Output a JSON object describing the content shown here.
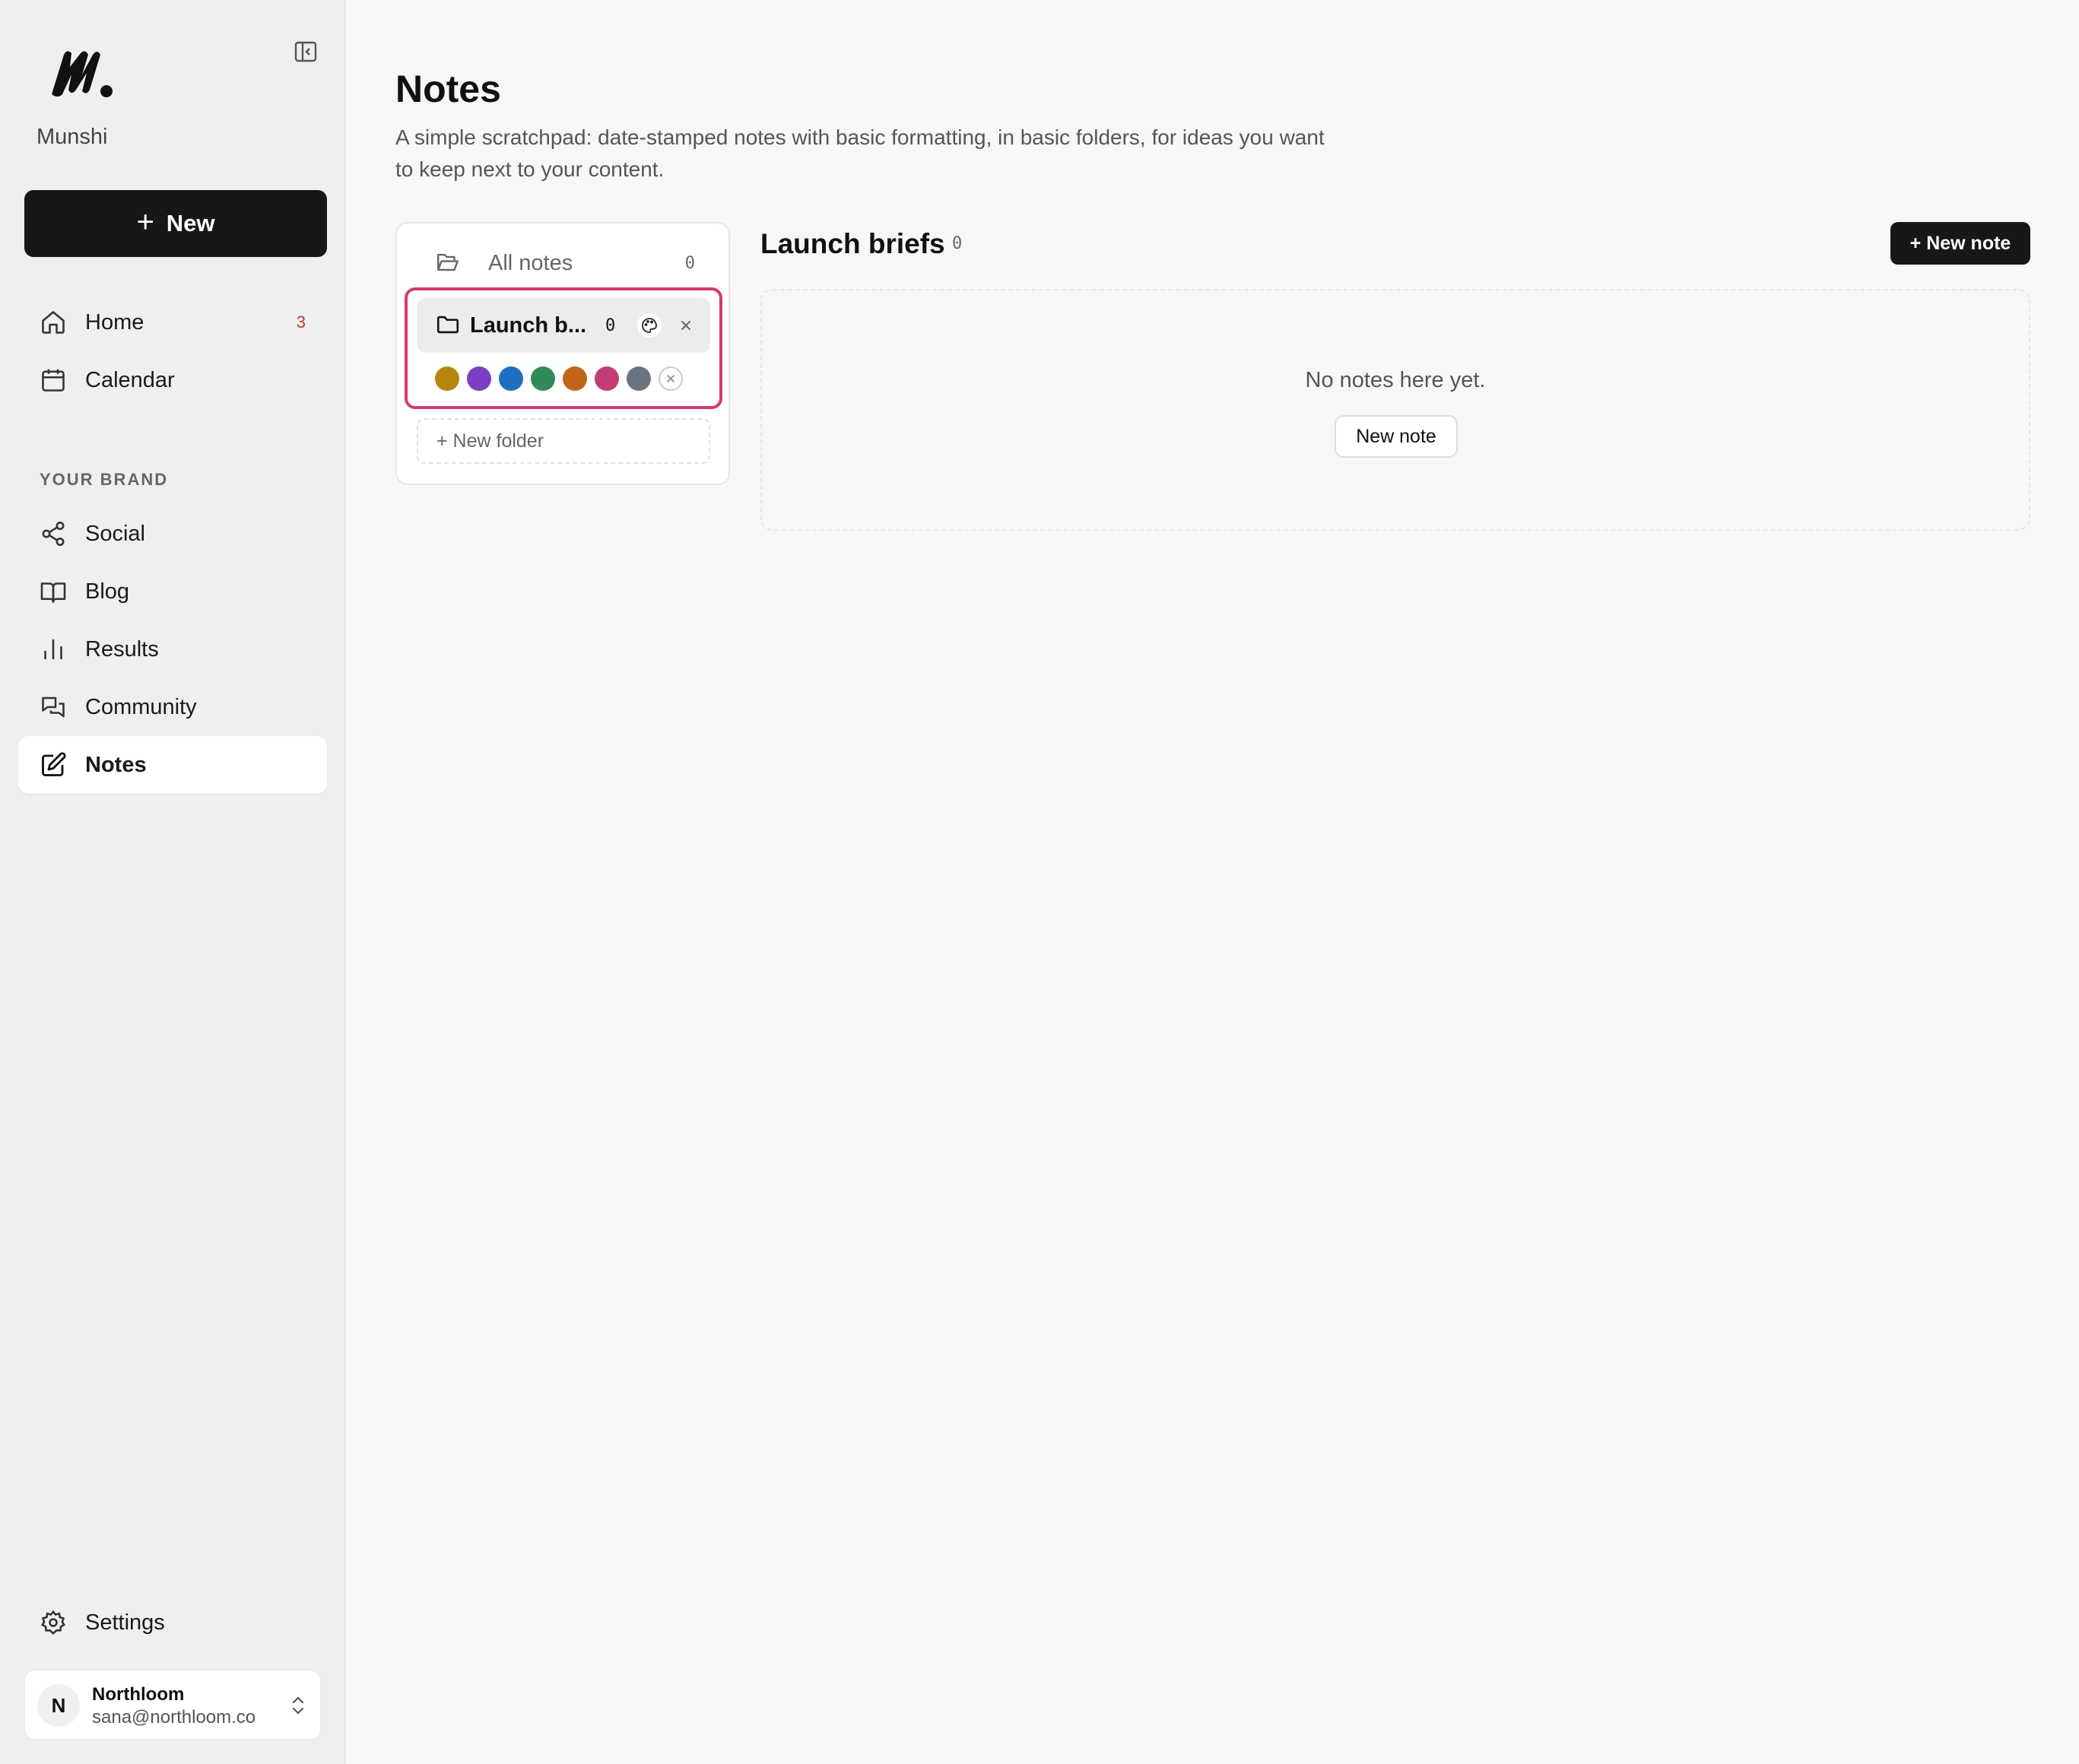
{
  "app": {
    "name": "Munshi"
  },
  "sidebar": {
    "new_label": "New",
    "nav": [
      {
        "label": "Home",
        "icon": "home-icon",
        "badge": "3"
      },
      {
        "label": "Calendar",
        "icon": "calendar-icon"
      }
    ],
    "section_label": "YOUR BRAND",
    "brand_nav": [
      {
        "label": "Social",
        "icon": "share-icon"
      },
      {
        "label": "Blog",
        "icon": "book-icon"
      },
      {
        "label": "Results",
        "icon": "bar-chart-icon"
      },
      {
        "label": "Community",
        "icon": "chat-icon"
      },
      {
        "label": "Notes",
        "icon": "edit-icon",
        "active": true
      }
    ],
    "settings_label": "Settings",
    "user": {
      "initial": "N",
      "name": "Northloom",
      "email": "sana@northloom.co"
    }
  },
  "main": {
    "title": "Notes",
    "description": "A simple scratchpad: date-stamped notes with basic formatting, in basic folders, for ideas you want to keep next to your content.",
    "folders": {
      "all_label": "All notes",
      "all_count": "0",
      "active_label": "Launch b...",
      "active_count": "0",
      "swatch_colors": [
        "#b8860b",
        "#7b3fc4",
        "#1f6fbf",
        "#2e8b57",
        "#c0641a",
        "#c23b73",
        "#6b7280"
      ],
      "new_folder_label": "+ New folder"
    },
    "list": {
      "title": "Launch briefs",
      "count": "0",
      "new_note_label": "+ New note",
      "empty_text": "No notes here yet.",
      "empty_button_label": "New note"
    }
  }
}
